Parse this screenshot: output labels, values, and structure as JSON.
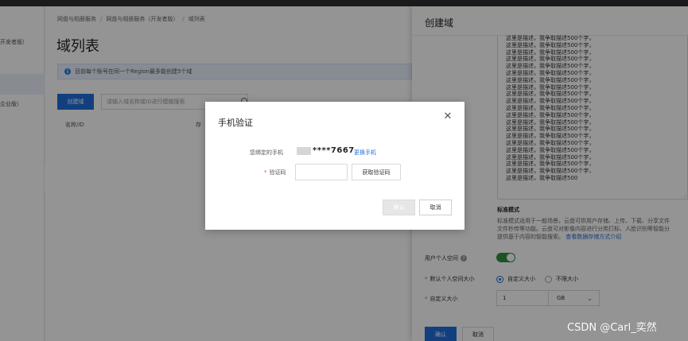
{
  "sidebar": {
    "items": [
      {
        "label": "开发者版）"
      },
      {
        "label": "企业版）"
      }
    ]
  },
  "breadcrumb": [
    "网盘与相册服务",
    "网盘与相册服务（开发者版）",
    "域列表"
  ],
  "page": {
    "title": "域列表",
    "notice": "目前每个账号在同一个Region最多能创建5个域",
    "create_button": "创建域",
    "search_placeholder": "请输入域名称或ID进行模糊搜索",
    "columns": [
      "名称/ID",
      "存"
    ]
  },
  "drawer": {
    "title": "创建域",
    "description_lines": [
      "这里是描述，我争取描述500个字，",
      "这里是描述，我争取描述500个字，",
      "这里是描述，我争取描述500个字，",
      "这里是描述，我争取描述500个字，",
      "这里是描述，我争取描述500个字，",
      "这里是描述，我争取描述500个字，",
      "这里是描述，我争取描述500个字，",
      "这里是描述，我争取描述500个字，",
      "这里是描述，我争取描述500个字，",
      "这里是描述，我争取描述500个字，",
      "这里是描述，我争取描述500个字，",
      "这里是描述，我争取描述500个字，",
      "这里是描述，我争取描述500个字，",
      "这里是描述，我争取描述500个字，",
      "这里是描述，我争取描述500个字，",
      "这里是描述，我争取描述500个字，",
      "这里是描述，我争取描述500个字，",
      "这里是描述，我争取描述500个字，",
      "这里是描述，我争取描述500个字，",
      "这里是描述，我争取描述500个字，",
      "这里是描述，我争取描述500"
    ],
    "mode_title": "标准模式",
    "mode_desc_lines": [
      "标准模式适用于一般场景，云盘可供用户存储、上传、下载、分享文件",
      "文件秒传等功能。云盘可对影像内容进行分类打标、人脸识别等智能分",
      "提供基于内容的智能搜索。"
    ],
    "mode_link": "查看数据存储方式介绍",
    "user_space_label": "用户个人空间",
    "user_space_enabled": true,
    "default_size_label": "默认个人空间大小",
    "radio_custom": "自定义大小",
    "radio_unlimited": "不限大小",
    "custom_size_label": "自定义大小",
    "custom_size_value": "1",
    "unit_value": "GB",
    "ok_button": "确认",
    "cancel_button": "取消"
  },
  "dialog": {
    "title": "手机验证",
    "bound_phone_label": "您绑定的手机",
    "phone_masked": "****7667",
    "change_phone_link": "更换手机",
    "code_label": "验证码",
    "code_value": "",
    "get_code_button": "获取验证码",
    "confirm_button": "确认",
    "cancel_button": "取消"
  },
  "watermark": "CSDN @Carl_奕然",
  "colors": {
    "primary": "#1f6fd9",
    "toggle_on": "#2f8f3f",
    "required": "#e84c3d"
  }
}
